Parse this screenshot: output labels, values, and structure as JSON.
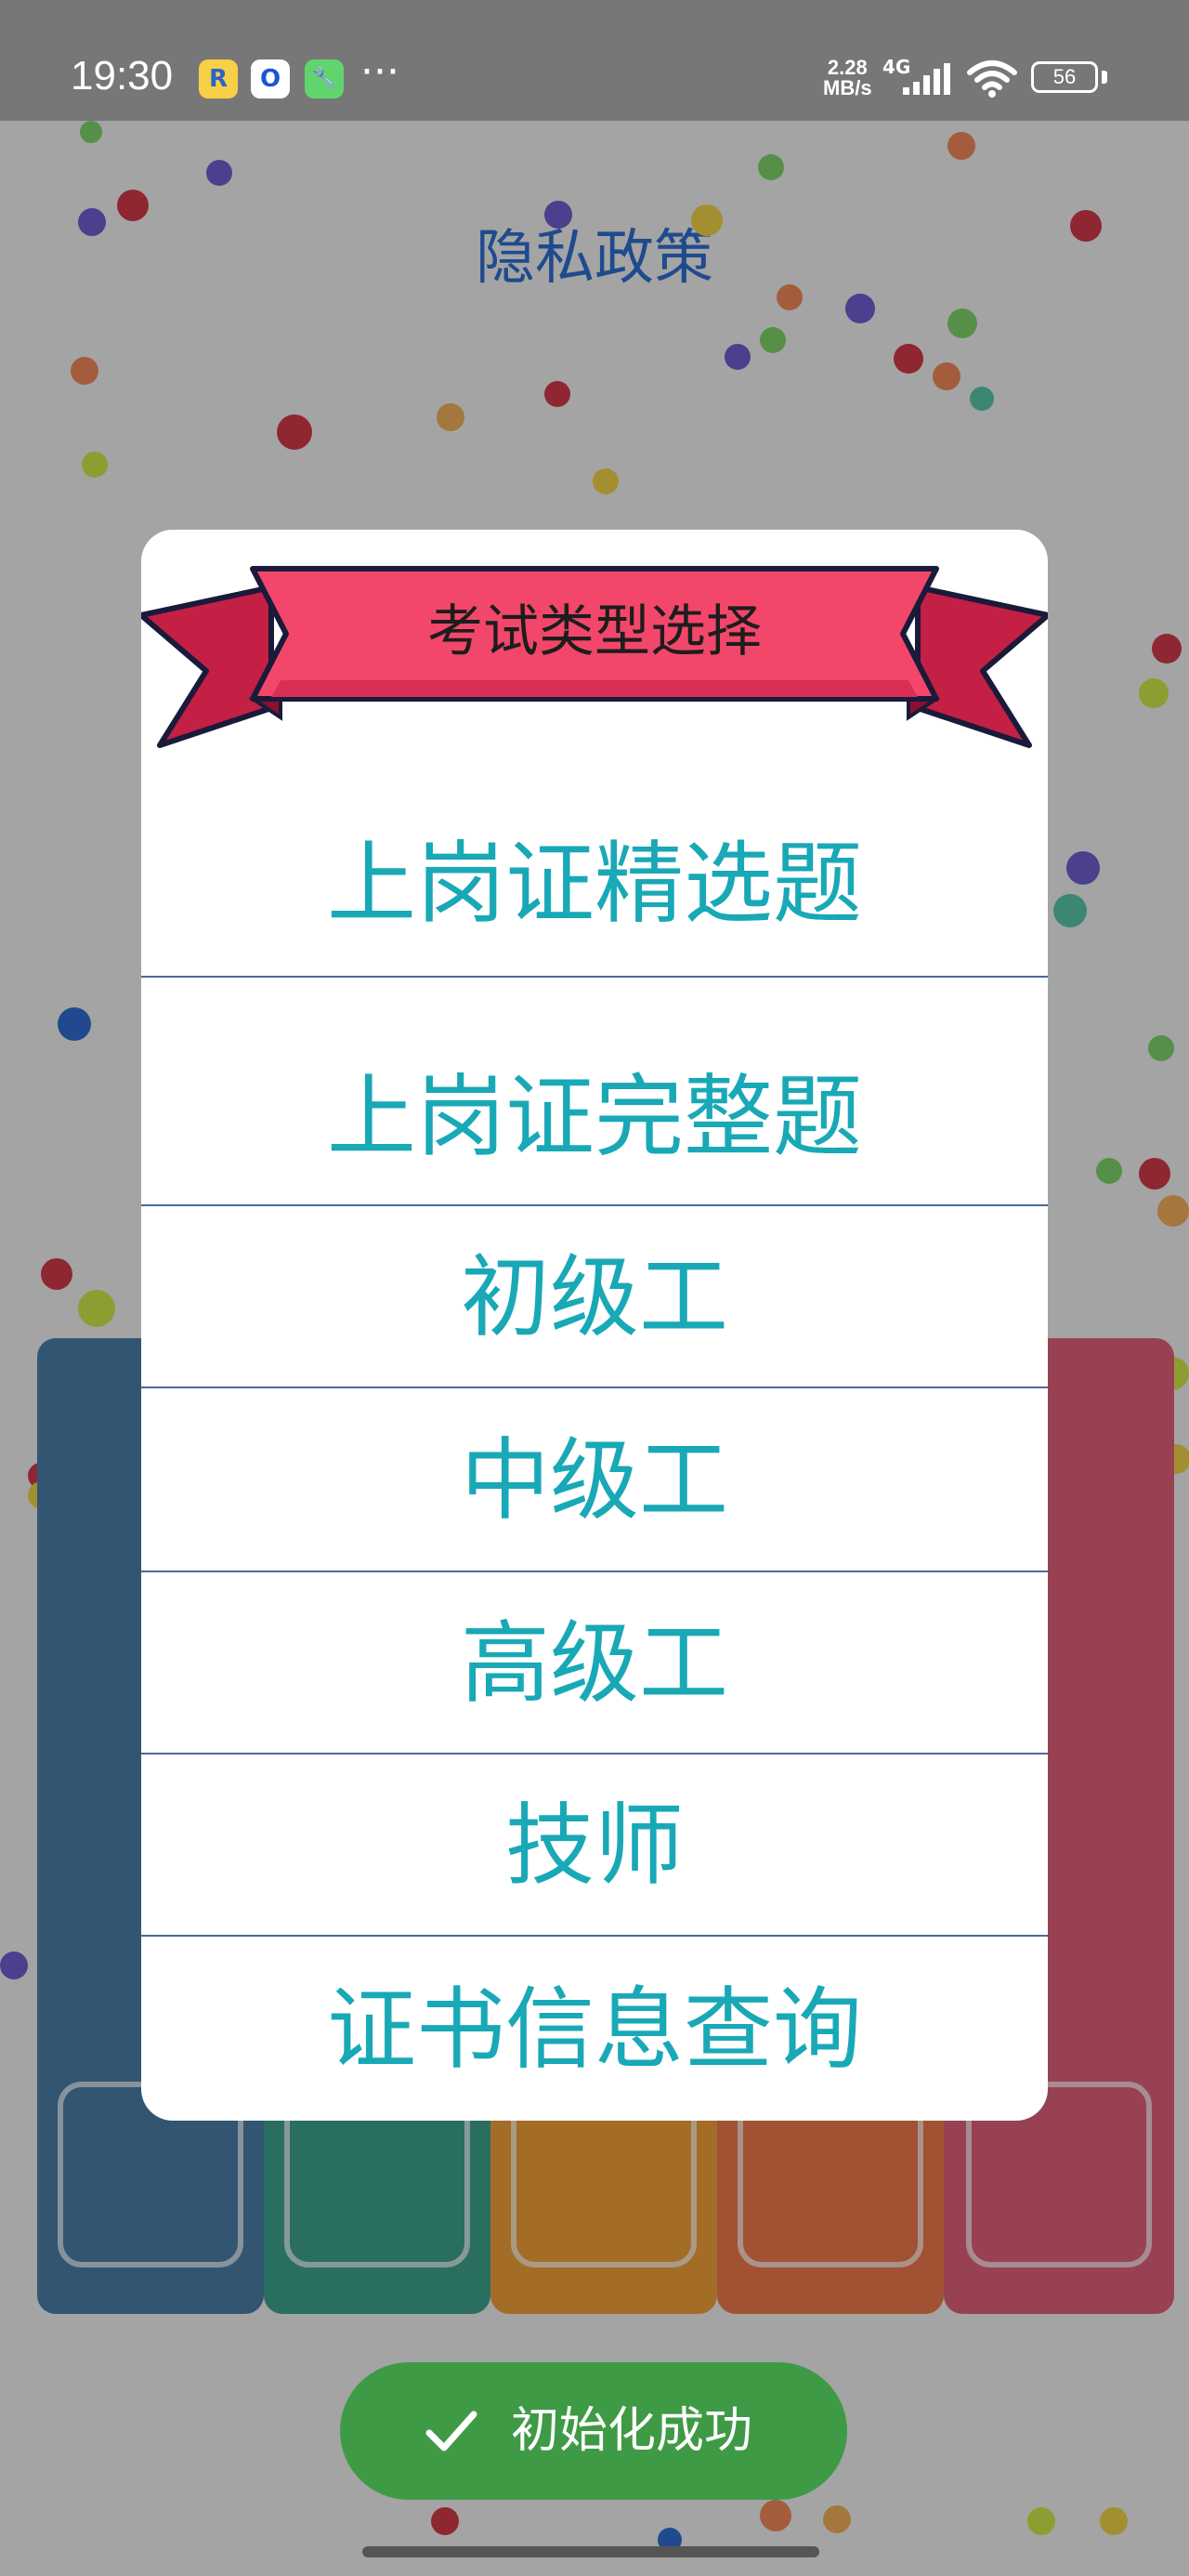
{
  "status_bar": {
    "time": "19:30",
    "app_icons": [
      {
        "name": "r-app-icon",
        "glyph": "R",
        "bg": "#f6d046",
        "fg": "#2b64c8"
      },
      {
        "name": "o-app-icon",
        "glyph": "O",
        "bg": "#ffffff",
        "fg": "#1a55d6"
      },
      {
        "name": "wrench-app-icon",
        "glyph": "🔧",
        "bg": "#62d46e",
        "fg": "#ffffff"
      }
    ],
    "more_dots": "···",
    "speed_value": "2.28",
    "speed_unit": "MB/s",
    "network_type": "4G",
    "battery_level": "56"
  },
  "background": {
    "title": "隐私政策"
  },
  "dialog": {
    "title": "考试类型选择",
    "options": [
      "上岗证精选题",
      "上岗证完整题",
      "初级工",
      "中级工",
      "高级工",
      "技师",
      "证书信息查询"
    ]
  },
  "toast": {
    "message": "初始化成功"
  },
  "colors": {
    "accent": "#19a8b6",
    "ribbon": "#e8435a",
    "toast": "#3f9a46"
  }
}
